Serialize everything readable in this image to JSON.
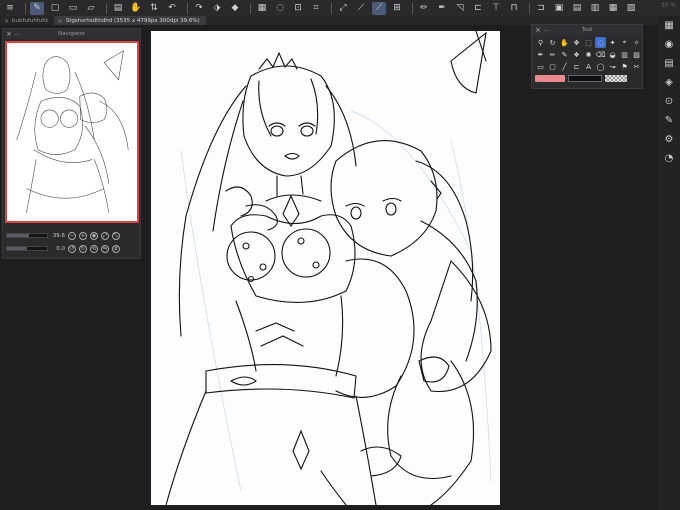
{
  "toolbar": {
    "buttons": [
      {
        "icon": "hamburger-menu-icon",
        "glyph": "≡"
      },
      {
        "icon": "pen-mode-icon",
        "glyph": "✎",
        "active": true
      },
      {
        "icon": "layout-icon",
        "glyph": "▢"
      },
      {
        "icon": "new-file-icon",
        "glyph": "▭"
      },
      {
        "icon": "open-folder-icon",
        "glyph": "▱"
      },
      {
        "icon": "save-icon",
        "glyph": "▤"
      },
      {
        "icon": "hand-icon",
        "glyph": "✋"
      },
      {
        "icon": "flip-icon",
        "glyph": "⇅"
      },
      {
        "icon": "undo-icon",
        "glyph": "↶"
      },
      {
        "icon": "redo-icon",
        "glyph": "↷"
      },
      {
        "icon": "clear-icon",
        "glyph": "⬗"
      },
      {
        "icon": "fill-icon",
        "glyph": "◆"
      },
      {
        "icon": "select-all-icon",
        "glyph": "▦"
      },
      {
        "icon": "lasso-icon",
        "glyph": "◌"
      },
      {
        "icon": "invert-select-icon",
        "glyph": "⊡"
      },
      {
        "icon": "crop-icon",
        "glyph": "⌗"
      },
      {
        "icon": "transform-icon",
        "glyph": "⤢"
      },
      {
        "icon": "ruler-icon",
        "glyph": "⟋"
      },
      {
        "icon": "snap-ruler-icon",
        "glyph": "⟋",
        "active": true
      },
      {
        "icon": "grid-icon",
        "glyph": "⊞"
      },
      {
        "icon": "pencil-icon",
        "glyph": "✏"
      },
      {
        "icon": "pen-icon",
        "glyph": "✒"
      },
      {
        "icon": "perspective-icon",
        "glyph": "◹"
      },
      {
        "icon": "frame-icon",
        "glyph": "⊏"
      },
      {
        "icon": "snap-icon",
        "glyph": "⊤"
      },
      {
        "icon": "guide-icon",
        "glyph": "⊓"
      },
      {
        "icon": "reference-icon",
        "glyph": "⊐"
      },
      {
        "icon": "layer-copy-icon",
        "glyph": "▣"
      },
      {
        "icon": "layer-paste-icon",
        "glyph": "▤"
      },
      {
        "icon": "layer-merge-icon",
        "glyph": "▥"
      },
      {
        "icon": "layer-mask-icon",
        "glyph": "▦"
      },
      {
        "icon": "layer-delete-icon",
        "glyph": "▧"
      }
    ],
    "corner_text": "30 %"
  },
  "tabs": [
    {
      "label": "bubfufuhfufd",
      "active": false
    },
    {
      "label": "Stgshsrhsdthdhd (3535 x 4799px 300dpi 39.6%)",
      "active": true
    }
  ],
  "navigator": {
    "title": "Navigator",
    "zoom_value": "39.6",
    "zoom_fraction": 0.55,
    "rotate_value": "0.0",
    "rotate_fraction": 0.5
  },
  "tool_panel": {
    "title": "Tool",
    "tools": [
      {
        "icon": "zoom-icon",
        "glyph": "⚲"
      },
      {
        "icon": "rotate-view-icon",
        "glyph": "↻"
      },
      {
        "icon": "hand-tool-icon",
        "glyph": "✋"
      },
      {
        "icon": "move-icon",
        "glyph": "✥"
      },
      {
        "icon": "marquee-icon",
        "glyph": "⬚"
      },
      {
        "icon": "lasso-tool-icon",
        "glyph": "◌",
        "active": true
      },
      {
        "icon": "auto-select-icon",
        "glyph": "✦"
      },
      {
        "icon": "eyedropper-icon",
        "glyph": "⌖"
      },
      {
        "icon": "magic-icon",
        "glyph": "✧"
      },
      {
        "icon": "pen-tool-icon",
        "glyph": "✒"
      },
      {
        "icon": "pencil-tool-icon",
        "glyph": "✏"
      },
      {
        "icon": "brush-icon",
        "glyph": "✎"
      },
      {
        "icon": "airbrush-icon",
        "glyph": "❖"
      },
      {
        "icon": "decoration-icon",
        "glyph": "✺"
      },
      {
        "icon": "eraser-icon",
        "glyph": "⌫"
      },
      {
        "icon": "blend-icon",
        "glyph": "◒"
      },
      {
        "icon": "fill-tool-icon",
        "glyph": "▥"
      },
      {
        "icon": "gradient-icon",
        "glyph": "▧"
      },
      {
        "icon": "figure-icon",
        "glyph": "▭"
      },
      {
        "icon": "frame-border-icon",
        "glyph": "▢"
      },
      {
        "icon": "line-icon",
        "glyph": "╱"
      },
      {
        "icon": "ruler-tool-icon",
        "glyph": "⊏"
      },
      {
        "icon": "text-icon",
        "glyph": "A"
      },
      {
        "icon": "balloon-icon",
        "glyph": "◯"
      },
      {
        "icon": "correct-line-icon",
        "glyph": "↝"
      },
      {
        "icon": "flag-icon",
        "glyph": "⚑"
      },
      {
        "icon": "other-icon",
        "glyph": "✂"
      }
    ],
    "main_color": "#e98a8e",
    "sub_color": "#0d0d14"
  },
  "right_sidebar": {
    "icons": [
      {
        "icon": "layer-property-icon",
        "glyph": "▦"
      },
      {
        "icon": "color-wheel-icon",
        "glyph": "◉"
      },
      {
        "icon": "material-icon",
        "glyph": "▤"
      },
      {
        "icon": "layer-icon",
        "glyph": "◈"
      },
      {
        "icon": "search-icon",
        "glyph": "⊙"
      },
      {
        "icon": "sub-tool-icon",
        "glyph": "✎"
      },
      {
        "icon": "tool-property-icon",
        "glyph": "⚙"
      },
      {
        "icon": "brush-size-icon",
        "glyph": "◔"
      }
    ]
  }
}
